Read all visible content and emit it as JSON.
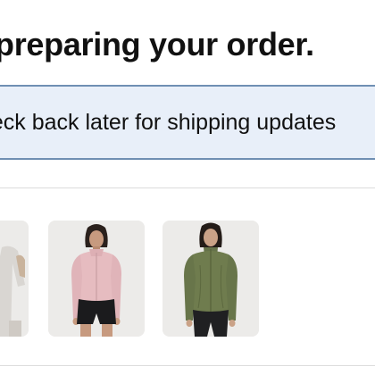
{
  "order": {
    "headline": "preparing your order.",
    "banner_text": "heck back later for shipping updates"
  },
  "items": [
    {
      "icon": "product-image-partial",
      "jacket_color": "#d9d6d2"
    },
    {
      "icon": "product-image-pink-jacket",
      "jacket_color": "#e6bcc0"
    },
    {
      "icon": "product-image-green-jacket",
      "jacket_color": "#6f7c4e"
    }
  ],
  "colors": {
    "banner_bg": "#e8eff9",
    "banner_border": "#6f8fb3",
    "thumb_bg": "#ecebe9"
  }
}
